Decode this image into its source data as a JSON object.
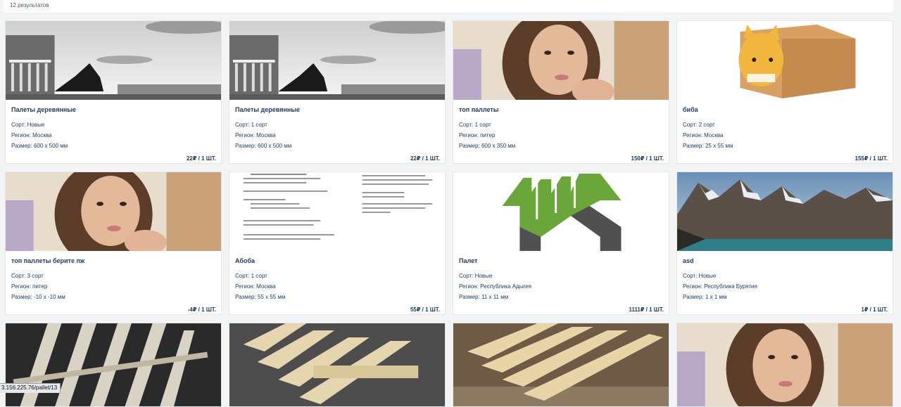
{
  "results": {
    "count_text": "12 результатов"
  },
  "cards": [
    {
      "title": "Палеты деревянные",
      "sort": "Сорт: Новые",
      "region": "Регион: Москва",
      "size": "Размер: 600 x 500 мм",
      "price": "22₽ / 1 ШТ.",
      "image": "city-monument-photo"
    },
    {
      "title": "Палеты деревянные",
      "sort": "Сорт: 1 сорт",
      "region": "Регион: Москва",
      "size": "Размер: 600 x 500 мм",
      "price": "22₽ / 1 ШТ.",
      "image": "city-monument-photo"
    },
    {
      "title": "топ паллеты",
      "sort": "Сорт: 1 сорт",
      "region": "Регион: питер",
      "size": "Размер: 600 x 350 мм",
      "price": "150₽ / 1 ШТ.",
      "image": "selfie-photo"
    },
    {
      "title": "биба",
      "sort": "Сорт: 2 сорт",
      "region": "Регион: Москва",
      "size": "Размер: 25 x 55 мм",
      "price": "155₽ / 1 ШТ.",
      "image": "cat-box-photo"
    },
    {
      "title": "топ паллеты берите пж",
      "sort": "Сорт: 3 сорт",
      "region": "Регион: питер",
      "size": "Размер: -10 x -10 мм",
      "price": "-4₽ / 1 ШТ.",
      "image": "selfie-photo"
    },
    {
      "title": "Абоба",
      "sort": "Сорт: 1 сорт",
      "region": "Регион: Москва",
      "size": "Размер: 55 x 55 мм",
      "price": "55₽ / 1 ШТ.",
      "image": "code-text-photo"
    },
    {
      "title": "Палет",
      "sort": "Сорт: Новые",
      "region": "Регион: Республика Адыгея",
      "size": "Размер: 11 x 11 мм",
      "price": "1111₽ / 1 ШТ.",
      "image": "arrows-logo"
    },
    {
      "title": "asd",
      "sort": "Сорт: Новые",
      "region": "Регион: Республика Бурятия",
      "size": "Размер: 1 x 1 мм",
      "price": "1₽ / 1 ШТ.",
      "image": "mountain-lake-photo"
    }
  ],
  "row3_images": [
    "pallet-photo-dark",
    "pallet-photo-asphalt",
    "pallet-photo-indoor",
    "selfie-photo"
  ],
  "status": {
    "url": "3.156.225.76/pallet/13"
  }
}
